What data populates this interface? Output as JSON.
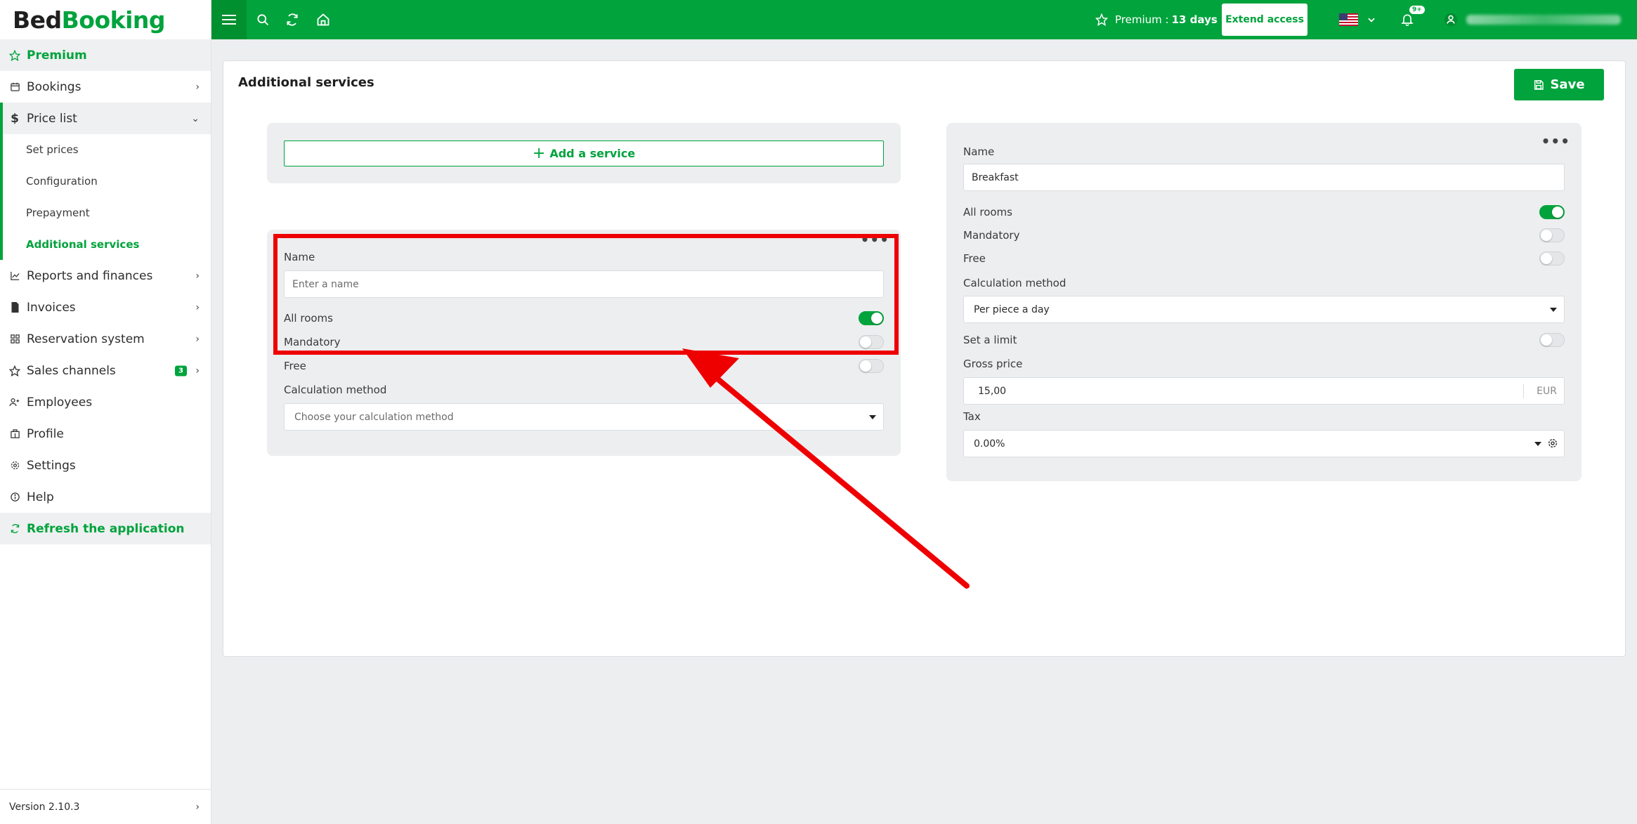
{
  "app": {
    "logo_part1": "Bed",
    "logo_part2": "Booking",
    "brand_color": "#00a33c"
  },
  "sidebar": {
    "premium": "Premium",
    "items": [
      {
        "label": "Bookings",
        "icon": "calendar-icon"
      },
      {
        "label": "Price list",
        "icon": "dollar-icon"
      },
      {
        "label": "Reports and finances",
        "icon": "chart-icon"
      },
      {
        "label": "Invoices",
        "icon": "invoice-icon"
      },
      {
        "label": "Reservation system",
        "icon": "grid-icon"
      },
      {
        "label": "Sales channels",
        "icon": "star-icon",
        "badge": "3"
      },
      {
        "label": "Employees",
        "icon": "user-plus-icon"
      },
      {
        "label": "Profile",
        "icon": "building-icon"
      },
      {
        "label": "Settings",
        "icon": "gear-icon"
      },
      {
        "label": "Help",
        "icon": "info-icon"
      }
    ],
    "sub_items": [
      "Set prices",
      "Configuration",
      "Prepayment",
      "Additional services"
    ],
    "refresh": "Refresh the application",
    "version": "Version 2.10.3"
  },
  "topbar": {
    "premium_label": "Premium :",
    "premium_days": "13 days",
    "extend_access": "Extend access",
    "notifications_badge": "9+"
  },
  "page": {
    "title": "Additional services",
    "save_label": "Save"
  },
  "left_column": {
    "add_service_label": "Add a service",
    "form": {
      "name_label": "Name",
      "name_placeholder": "Enter a name",
      "all_rooms_label": "All rooms",
      "all_rooms_on": true,
      "mandatory_label": "Mandatory",
      "mandatory_on": false,
      "free_label": "Free",
      "free_on": false,
      "calc_label": "Calculation method",
      "calc_placeholder": "Choose your calculation method"
    }
  },
  "right_column": {
    "name_label": "Name",
    "name_value": "Breakfast",
    "all_rooms_label": "All rooms",
    "all_rooms_on": true,
    "mandatory_label": "Mandatory",
    "mandatory_on": false,
    "free_label": "Free",
    "free_on": false,
    "calc_label": "Calculation method",
    "calc_value": "Per piece a day",
    "limit_label": "Set a limit",
    "limit_on": false,
    "gross_label": "Gross price",
    "gross_value": "15,00",
    "currency": "EUR",
    "tax_label": "Tax",
    "tax_value": "0.00%"
  },
  "annotation": {
    "highlight_color": "#ef0000"
  }
}
